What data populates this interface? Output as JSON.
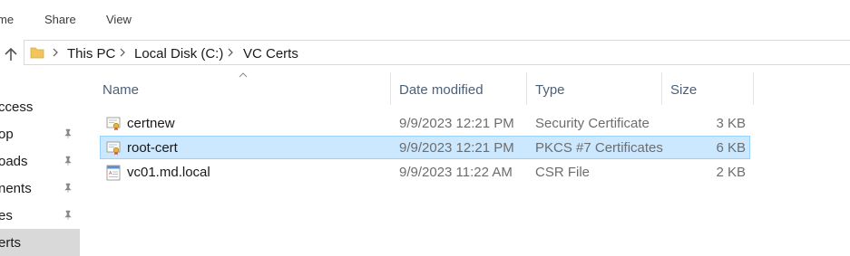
{
  "ribbon": {
    "tabs": [
      "me",
      "Share",
      "View"
    ]
  },
  "address": {
    "crumbs": [
      "This PC",
      "Local Disk (C:)",
      "VC Certs"
    ]
  },
  "sidebar": {
    "items": [
      {
        "label": "ccess",
        "pinned": false,
        "selected": false
      },
      {
        "label": "op",
        "pinned": true,
        "selected": false
      },
      {
        "label": "oads",
        "pinned": true,
        "selected": false
      },
      {
        "label": "nents",
        "pinned": true,
        "selected": false
      },
      {
        "label": "es",
        "pinned": true,
        "selected": false
      },
      {
        "label": "erts",
        "pinned": false,
        "selected": true
      }
    ]
  },
  "columns": [
    "Name",
    "Date modified",
    "Type",
    "Size"
  ],
  "files": [
    {
      "name": "certnew",
      "date": "9/9/2023 12:21 PM",
      "type": "Security Certificate",
      "size": "3 KB",
      "icon": "certificate-icon",
      "selected": false
    },
    {
      "name": "root-cert",
      "date": "9/9/2023 12:21 PM",
      "type": "PKCS #7 Certificates",
      "size": "6 KB",
      "icon": "certificate-icon",
      "selected": true
    },
    {
      "name": "vc01.md.local",
      "date": "9/9/2023 11:22 AM",
      "type": "CSR File",
      "size": "2 KB",
      "icon": "csr-file-icon",
      "selected": false
    }
  ],
  "colors": {
    "selection_bg": "#cce8ff",
    "selection_border": "#99d1ff",
    "header_text": "#4c607a"
  }
}
